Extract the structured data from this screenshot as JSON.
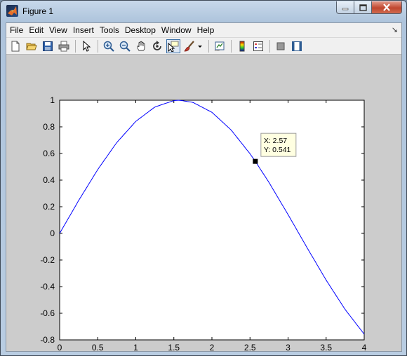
{
  "window": {
    "title": "Figure 1"
  },
  "menu": {
    "items": [
      "File",
      "Edit",
      "View",
      "Insert",
      "Tools",
      "Desktop",
      "Window",
      "Help"
    ],
    "dock_arrow": "↘"
  },
  "toolbar": {
    "buttons": [
      "new-figure-icon",
      "open-file-icon",
      "save-icon",
      "print-icon",
      "edit-plot-icon",
      "zoom-in-icon",
      "zoom-out-icon",
      "pan-icon",
      "rotate-3d-icon",
      "data-cursor-icon",
      "brush-icon",
      "brush-dropdown-icon",
      "link-plot-icon",
      "colorbar-icon",
      "legend-icon",
      "hide-plot-tools-icon",
      "show-plot-tools-icon"
    ],
    "active": "data-cursor-icon"
  },
  "chart_data": {
    "type": "line",
    "title": "",
    "xlabel": "",
    "ylabel": "",
    "xlim": [
      0,
      4
    ],
    "ylim": [
      -0.8,
      1
    ],
    "xticks": [
      "0",
      "0.5",
      "1",
      "1.5",
      "2",
      "2.5",
      "3",
      "3.5",
      "4"
    ],
    "yticks": [
      "1",
      "0.8",
      "0.6",
      "0.4",
      "0.2",
      "0",
      "-0.2",
      "-0.4",
      "-0.6",
      "-0.8"
    ],
    "series": [
      {
        "color": "#0000ff",
        "x": [
          0,
          0.25,
          0.5,
          0.75,
          1,
          1.25,
          1.5,
          1.57,
          1.75,
          2,
          2.25,
          2.5,
          2.57,
          2.75,
          3,
          3.25,
          3.5,
          3.75,
          4
        ],
        "y": [
          0,
          0.247,
          0.479,
          0.682,
          0.841,
          0.949,
          0.997,
          1,
          0.984,
          0.909,
          0.778,
          0.598,
          0.541,
          0.382,
          0.141,
          -0.108,
          -0.351,
          -0.572,
          -0.757
        ]
      }
    ],
    "datatip": {
      "x": 2.57,
      "y": 0.541,
      "x_label": "X: 2.57",
      "y_label": "Y: 0.541"
    },
    "grid": false
  }
}
